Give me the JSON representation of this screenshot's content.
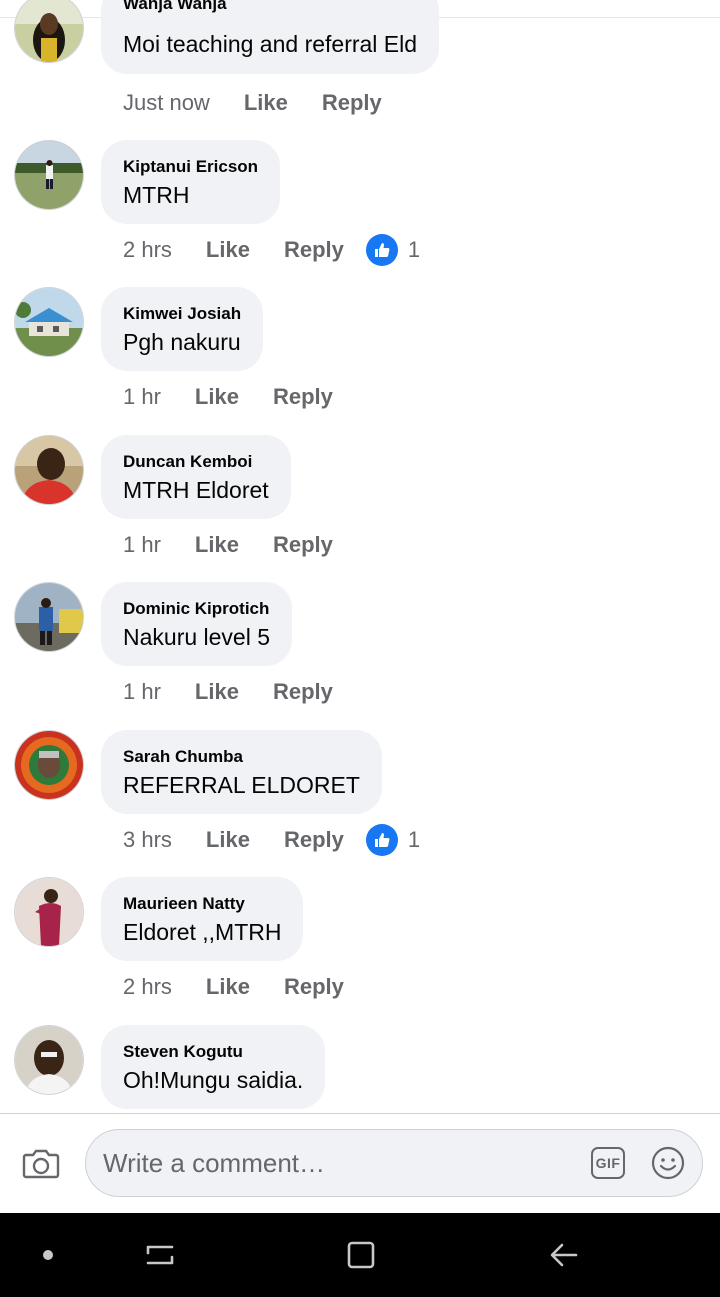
{
  "comments": [
    {
      "author": "Wanja Wanja",
      "text": "Moi teaching and referral Eld",
      "time": "Just now",
      "like_label": "Like",
      "reply_label": "Reply",
      "reactions": null
    },
    {
      "author": "Kiptanui Ericson",
      "text": "MTRH",
      "time": "2 hrs",
      "like_label": "Like",
      "reply_label": "Reply",
      "reactions": "1"
    },
    {
      "author": "Kimwei Josiah",
      "text": "Pgh nakuru",
      "time": "1 hr",
      "like_label": "Like",
      "reply_label": "Reply",
      "reactions": null
    },
    {
      "author": "Duncan Kemboi",
      "text": "MTRH  Eldoret",
      "time": "1 hr",
      "like_label": "Like",
      "reply_label": "Reply",
      "reactions": null
    },
    {
      "author": "Dominic Kiprotich",
      "text": "Nakuru level 5",
      "time": "1 hr",
      "like_label": "Like",
      "reply_label": "Reply",
      "reactions": null
    },
    {
      "author": "Sarah Chumba",
      "text": "REFERRAL ELDORET",
      "time": "3 hrs",
      "like_label": "Like",
      "reply_label": "Reply",
      "reactions": "1"
    },
    {
      "author": "Maurieen Natty",
      "text": "Eldoret ,,MTRH",
      "time": "2 hrs",
      "like_label": "Like",
      "reply_label": "Reply",
      "reactions": null
    },
    {
      "author": "Steven Kogutu",
      "text": "Oh!Mungu saidia.",
      "time": null,
      "like_label": null,
      "reply_label": null,
      "reactions": null
    }
  ],
  "composer": {
    "placeholder": "Write a comment…",
    "gif_label": "GIF",
    "camera_icon": "camera-icon",
    "emoji_icon": "emoji-icon"
  },
  "navbar": {
    "icons": [
      "dot-icon",
      "recent-apps-icon",
      "home-icon",
      "back-icon"
    ]
  },
  "colors": {
    "bubble": "#f0f2f5",
    "meta_text": "#65676b",
    "like_blue": "#1877f2",
    "navbar": "#000000"
  }
}
